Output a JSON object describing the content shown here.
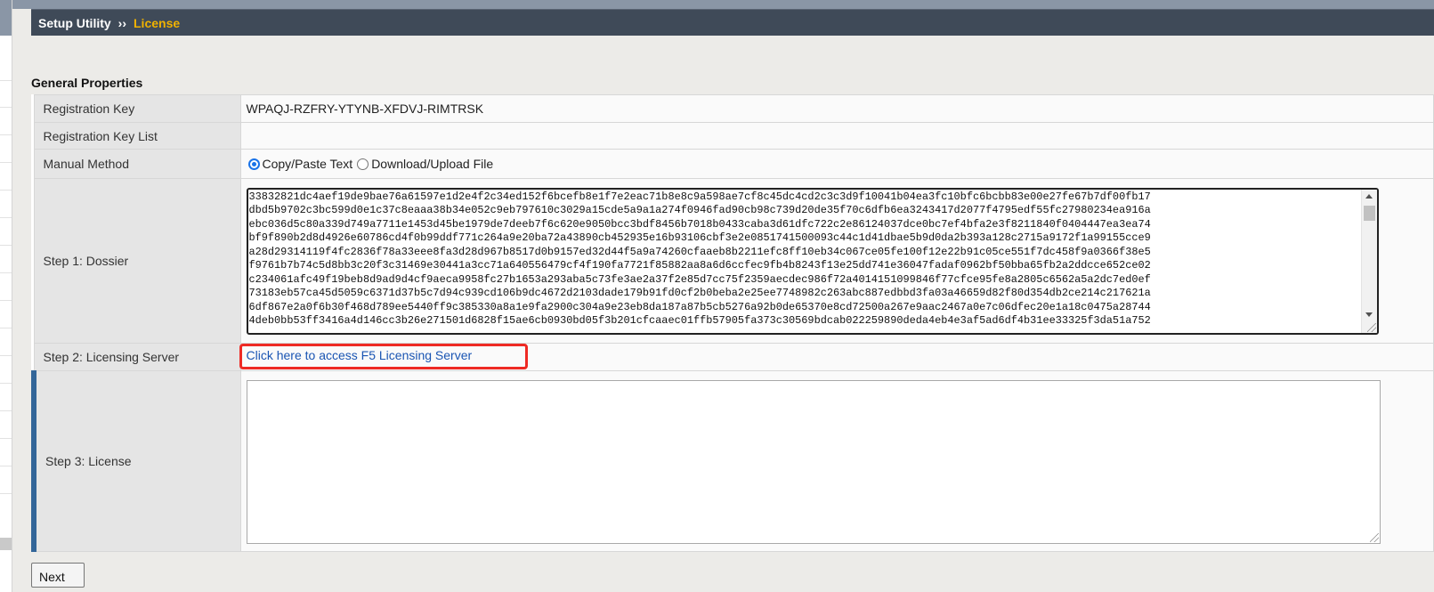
{
  "breadcrumb": {
    "parent": "Setup Utility",
    "separator": "››",
    "current": "License"
  },
  "section_title": "General Properties",
  "rows": {
    "registration_key": {
      "label": "Registration Key",
      "value": "WPAQJ-RZFRY-YTYNB-XFDVJ-RIMTRSK"
    },
    "registration_key_list": {
      "label": "Registration Key List",
      "value": ""
    },
    "manual_method": {
      "label": "Manual Method",
      "options": [
        {
          "label": "Copy/Paste Text",
          "checked": true
        },
        {
          "label": "Download/Upload File",
          "checked": false
        }
      ]
    },
    "dossier": {
      "label": "Step 1: Dossier",
      "text": "33832821dc4aef19de9bae76a61597e1d2e4f2c34ed152f6bcefb8e1f7e2eac71b8e8c9a598ae7cf8c45dc4cd2c3c3d9f10041b04ea3fc10bfc6bcbb83e00e27fe67b7df00fb17\ndbd5b9702c3bc599d0e1c37c8eaaa38b34e052c9eb797610c3029a15cde5a9a1a274f0946fad90cb98c739d20de35f70c6dfb6ea3243417d2077f4795edf55fc27980234ea916a\nebc036d5c80a339d749a7711e1453d45be1979de7deeb7f6c620e9050bcc3bdf8456b7018b0433caba3d61dfc722c2e86124037dce0bc7ef4bfa2e3f8211840f0404447ea3ea74\nbf9f890b2d8d4926e60786cd4f0b99ddf771c264a9e20ba72a43890cb452935e16b93106cbf3e2e0851741500093c44c1d41dbae5b9d0da2b393a128c2715a9172f1a99155cce9\na28d29314119f4fc2836f78a33eee8fa3d28d967b8517d0b9157ed32d44f5a9a74260cfaaeb8b2211efc8ff10eb34c067ce05fe100f12e22b91c05ce551f7dc458f9a0366f38e5\nf9761b7b74c5d8bb3c20f3c31469e30441a3cc71a640556479cf4f190fa7721f85882aa8a6d6ccfec9fb4b8243f13e25dd741e36047fadaf0962bf50bba65fb2a2ddcce652ce02\nc234061afc49f19beb8d9ad9d4cf9aeca9958fc27b1653a293aba5c73fe3ae2a37f2e85d7cc75f2359aecdec986f72a4014151099846f77cfce95fe8a2805c6562a5a2dc7ed0ef\n73183eb57ca45d5059c6371d37b5c7d94c939cd106b9dc4672d2103dade179b91fd0cf2b0beba2e25ee7748982c263abc887edbbd3fa03a46659d82f80d354db2ce214c217621a\n6df867e2a0f6b30f468d789ee5440ff9c385330a8a1e9fa2900c304a9e23eb8da187a87b5cb5276a92b0de65370e8cd72500a267e9aac2467a0e7c06dfec20e1a18c0475a28744\n4deb0bb53ff3416a4d146cc3b26e271501d6828f15ae6cb0930bd05f3b201cfcaaec01ffb57905fa373c30569bdcab022259890deda4eb4e3af5ad6df4b31ee33325f3da51a752"
    },
    "licensing_server": {
      "label": "Step 2: Licensing Server",
      "link_text": "Click here to access F5 Licensing Server"
    },
    "license": {
      "label": "Step 3: License",
      "value": ""
    }
  },
  "next_button": "Next",
  "colors": {
    "title_bar": "#3f4a58",
    "breadcrumb_current": "#f0b200",
    "link": "#1a55b3",
    "highlight_box": "#ee2a24",
    "required_marker": "#336699"
  }
}
